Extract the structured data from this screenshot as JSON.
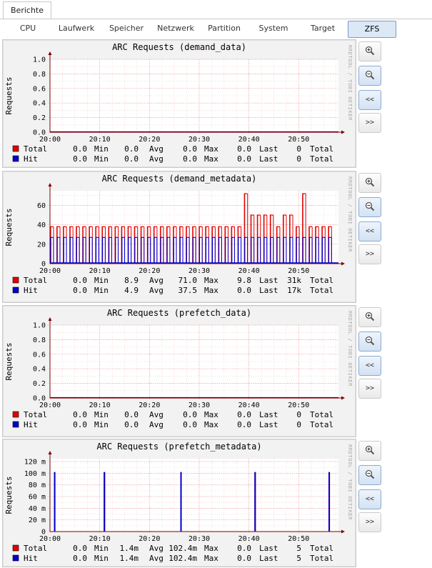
{
  "top_tab": {
    "label": "Berichte"
  },
  "subtabs": [
    {
      "label": "CPU",
      "active": false
    },
    {
      "label": "Laufwerk",
      "active": false
    },
    {
      "label": "Speicher",
      "active": false
    },
    {
      "label": "Netzwerk",
      "active": false
    },
    {
      "label": "Partition",
      "active": false
    },
    {
      "label": "System",
      "active": false
    },
    {
      "label": "Target",
      "active": false
    },
    {
      "label": "ZFS",
      "active": true
    }
  ],
  "side_buttons": {
    "zoom_in": "zoom-in-icon",
    "zoom_out": "zoom-out-icon",
    "back": "<<",
    "forward": ">>"
  },
  "watermark": "RRDTOOL / TOBI OETIKER",
  "colors": {
    "total": "#e00000",
    "hit": "#0000cc",
    "grid": "#f0a0a0",
    "axis": "#800000"
  },
  "charts": [
    {
      "title": "ARC Requests (demand_data)",
      "ylabel": "Requests",
      "x_ticks": [
        "20:00",
        "20:10",
        "20:20",
        "20:30",
        "20:40",
        "20:50"
      ],
      "y_ticks": [
        "0.0",
        "0.2",
        "0.4",
        "0.6",
        "0.8",
        "1.0"
      ],
      "legend": [
        {
          "name": "Total",
          "min_label": "Min",
          "min": "0.0",
          "avg_label": "Avg",
          "avg": "0.0",
          "max_label": "Max",
          "max": "0.0",
          "last_label": "Last",
          "last": "0.0",
          "total_label": "Total",
          "total": "0",
          "first": "0.0"
        },
        {
          "name": "Hit",
          "min_label": "Min",
          "min": "0.0",
          "avg_label": "Avg",
          "avg": "0.0",
          "max_label": "Max",
          "max": "0.0",
          "last_label": "Last",
          "last": "0.0",
          "total_label": "Total",
          "total": "0",
          "first": "0.0"
        }
      ]
    },
    {
      "title": "ARC Requests (demand_metadata)",
      "ylabel": "Requests",
      "x_ticks": [
        "20:00",
        "20:10",
        "20:20",
        "20:30",
        "20:40",
        "20:50"
      ],
      "y_ticks": [
        "0",
        "20",
        "40",
        "60"
      ],
      "legend": [
        {
          "name": "Total",
          "first": "0.0",
          "min_label": "Min",
          "min": "8.9",
          "avg_label": "Avg",
          "avg": "71.0",
          "max_label": "Max",
          "max": "9.8",
          "last_label": "Last",
          "last": "31k",
          "total_label": "Total"
        },
        {
          "name": "Hit",
          "first": "0.0",
          "min_label": "Min",
          "min": "4.9",
          "avg_label": "Avg",
          "avg": "37.5",
          "max_label": "Max",
          "max": "0.0",
          "last_label": "Last",
          "last": "17k",
          "total_label": "Total"
        }
      ]
    },
    {
      "title": "ARC Requests (prefetch_data)",
      "ylabel": "Requests",
      "x_ticks": [
        "20:00",
        "20:10",
        "20:20",
        "20:30",
        "20:40",
        "20:50"
      ],
      "y_ticks": [
        "0.0",
        "0.2",
        "0.4",
        "0.6",
        "0.8",
        "1.0"
      ],
      "legend": [
        {
          "name": "Total",
          "first": "0.0",
          "min_label": "Min",
          "min": "0.0",
          "avg_label": "Avg",
          "avg": "0.0",
          "max_label": "Max",
          "max": "0.0",
          "last_label": "Last",
          "last": "0",
          "total_label": "Total"
        },
        {
          "name": "Hit",
          "first": "0.0",
          "min_label": "Min",
          "min": "0.0",
          "avg_label": "Avg",
          "avg": "0.0",
          "max_label": "Max",
          "max": "0.0",
          "last_label": "Last",
          "last": "0",
          "total_label": "Total"
        }
      ]
    },
    {
      "title": "ARC Requests (prefetch_metadata)",
      "ylabel": "Requests",
      "x_ticks": [
        "20:00",
        "20:10",
        "20:20",
        "20:30",
        "20:40",
        "20:50"
      ],
      "y_ticks": [
        "0",
        "20 m",
        "40 m",
        "60 m",
        "80 m",
        "100 m",
        "120 m"
      ],
      "legend": [
        {
          "name": "Total",
          "first": "0.0",
          "min_label": "Min",
          "min": "1.4m",
          "avg_label": "Avg",
          "avg": "102.4m",
          "max_label": "Max",
          "max": "0.0",
          "last_label": "Last",
          "last": "5",
          "total_label": "Total"
        },
        {
          "name": "Hit",
          "first": "0.0",
          "min_label": "Min",
          "min": "1.4m",
          "avg_label": "Avg",
          "avg": "102.4m",
          "max_label": "Max",
          "max": "0.0",
          "last_label": "Last",
          "last": "5",
          "total_label": "Total"
        }
      ]
    }
  ],
  "chart_data": [
    {
      "type": "line",
      "title": "ARC Requests (demand_data)",
      "ylabel": "Requests",
      "xlim": [
        "20:00",
        "20:58"
      ],
      "ylim": [
        0,
        1.0
      ],
      "grid": true,
      "series": [
        {
          "name": "Total",
          "color": "#e00000",
          "x_minutes": [
            0,
            58
          ],
          "values": [
            0,
            0
          ]
        },
        {
          "name": "Hit",
          "color": "#0000cc",
          "x_minutes": [
            0,
            58
          ],
          "values": [
            0,
            0
          ]
        }
      ]
    },
    {
      "type": "bar",
      "title": "ARC Requests (demand_metadata)",
      "ylabel": "Requests",
      "xlim": [
        "20:00",
        "20:58"
      ],
      "ylim": [
        0,
        75
      ],
      "grid": true,
      "series": [
        {
          "name": "Total",
          "color": "#e00000",
          "x_minutes": [
            0,
            1.3,
            2.6,
            3.9,
            5.2,
            6.5,
            7.8,
            9.1,
            10.4,
            11.7,
            13,
            14.3,
            15.6,
            16.9,
            18.2,
            19.5,
            20.8,
            22.1,
            23.4,
            24.7,
            26,
            27.3,
            28.6,
            29.9,
            31.2,
            32.5,
            33.8,
            35.1,
            36.4,
            37.7,
            39,
            40.3,
            41.6,
            42.9,
            44.2,
            45.5,
            46.8,
            48.1,
            49.4,
            50.7,
            52,
            53.3,
            54.6,
            55.9
          ],
          "values": [
            38,
            38,
            38,
            38,
            38,
            38,
            38,
            38,
            38,
            38,
            38,
            38,
            38,
            38,
            38,
            38,
            38,
            38,
            38,
            38,
            38,
            38,
            38,
            38,
            38,
            38,
            38,
            38,
            38,
            38,
            72,
            50,
            50,
            50,
            50,
            38,
            50,
            50,
            38,
            72,
            38,
            38,
            38,
            38
          ]
        },
        {
          "name": "Hit",
          "color": "#0000cc",
          "x_minutes": [
            0,
            1.3,
            2.6,
            3.9,
            5.2,
            6.5,
            7.8,
            9.1,
            10.4,
            11.7,
            13,
            14.3,
            15.6,
            16.9,
            18.2,
            19.5,
            20.8,
            22.1,
            23.4,
            24.7,
            26,
            27.3,
            28.6,
            29.9,
            31.2,
            32.5,
            33.8,
            35.1,
            36.4,
            37.7,
            39,
            40.3,
            41.6,
            42.9,
            44.2,
            45.5,
            46.8,
            48.1,
            49.4,
            50.7,
            52,
            53.3,
            54.6,
            55.9
          ],
          "values": [
            27,
            27,
            27,
            27,
            27,
            27,
            27,
            27,
            27,
            27,
            27,
            27,
            27,
            27,
            27,
            27,
            27,
            27,
            27,
            27,
            27,
            27,
            27,
            27,
            27,
            27,
            27,
            27,
            27,
            27,
            27,
            27,
            27,
            27,
            27,
            27,
            27,
            27,
            27,
            27,
            27,
            27,
            27,
            27
          ]
        }
      ]
    },
    {
      "type": "line",
      "title": "ARC Requests (prefetch_data)",
      "ylabel": "Requests",
      "xlim": [
        "20:00",
        "20:58"
      ],
      "ylim": [
        0,
        1.0
      ],
      "grid": true,
      "series": [
        {
          "name": "Total",
          "color": "#e00000",
          "x_minutes": [
            0,
            58
          ],
          "values": [
            0,
            0
          ]
        },
        {
          "name": "Hit",
          "color": "#0000cc",
          "x_minutes": [
            0,
            58
          ],
          "values": [
            0,
            0
          ]
        }
      ]
    },
    {
      "type": "bar",
      "title": "ARC Requests (prefetch_metadata)",
      "ylabel": "Requests",
      "xlim": [
        "20:00",
        "20:58"
      ],
      "ylim": [
        0,
        125
      ],
      "grid": true,
      "series": [
        {
          "name": "Total",
          "color": "#e00000",
          "x_minutes": [
            0.8,
            10.8,
            26.2,
            41.1,
            56
          ],
          "values": [
            102,
            102,
            102,
            102,
            102
          ]
        },
        {
          "name": "Hit",
          "color": "#0000cc",
          "x_minutes": [
            0.8,
            10.8,
            26.2,
            41.1,
            56
          ],
          "values": [
            102,
            102,
            102,
            102,
            102
          ]
        }
      ]
    }
  ]
}
